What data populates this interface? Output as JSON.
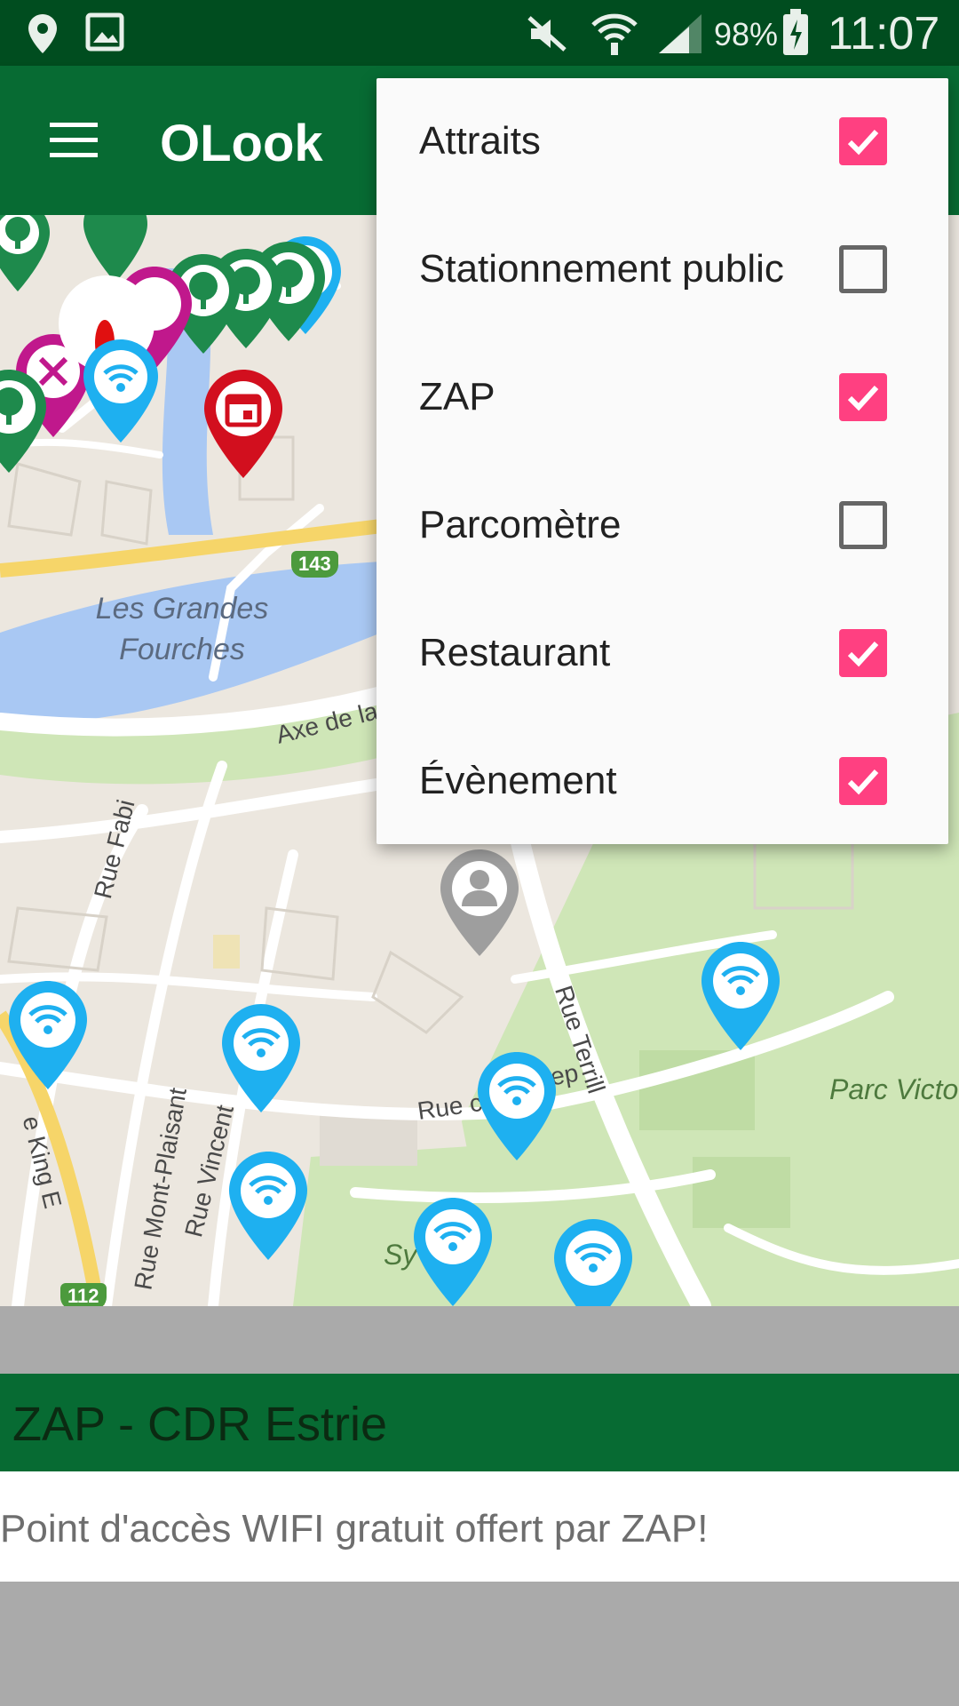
{
  "status_bar": {
    "battery": "98%",
    "time": "11:07",
    "icons": [
      "location-icon",
      "image-icon",
      "mute-icon",
      "wifi-icon",
      "signal-icon",
      "battery-charging-icon"
    ]
  },
  "app_bar": {
    "title": "OLook",
    "menu_icon": "hamburger-menu-icon"
  },
  "filter_menu": {
    "items": [
      {
        "label": "Attraits",
        "checked": true
      },
      {
        "label": "Stationnement public",
        "checked": false
      },
      {
        "label": "ZAP",
        "checked": true
      },
      {
        "label": "Parcomètre",
        "checked": false
      },
      {
        "label": "Restaurant",
        "checked": true
      },
      {
        "label": "Évènement",
        "checked": true
      }
    ],
    "accent_color": "#ff4081"
  },
  "map": {
    "place_labels": {
      "river": "Les Grandes\nFourches",
      "park": "Parc Victo",
      "park2": "Sy        aigle"
    },
    "streets": {
      "axe": "Axe de la",
      "fabi": "Rue Fabi",
      "terrill": "Rue Terrill",
      "king": "e King E",
      "mont_plaisant": "Rue Mont-Plaisant",
      "vincent": "Rue Vincent",
      "rue_c": "Rue c",
      "ep": "ep"
    },
    "route_badges": [
      "143",
      "112"
    ],
    "marker_colors": {
      "wifi": "#1eb0f0",
      "attrait": "#1e8a4c",
      "restaurant": "#c0188c",
      "event": "#d20f1e",
      "user": "#9e9e9e"
    }
  },
  "info_panel": {
    "title": "ZAP - CDR Estrie",
    "description": "Point d'accès WIFI gratuit offert par ZAP!"
  }
}
